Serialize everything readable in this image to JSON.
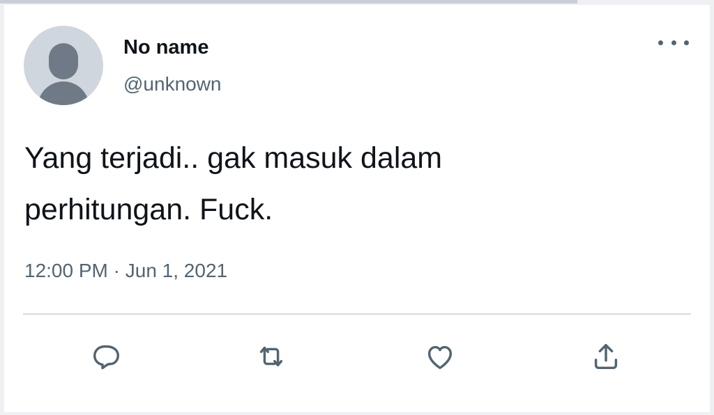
{
  "tweet": {
    "author_name": "No name",
    "author_handle": "@unknown",
    "text_line1": "Yang terjadi.. gak masuk dalam",
    "text_line2": "perhitungan. Fuck.",
    "time": "12:00 PM",
    "separator": "·",
    "date": "Jun 1, 2021"
  },
  "icons": {
    "more": "more-options-icon",
    "reply": "reply-icon",
    "retweet": "retweet-icon",
    "like": "like-icon",
    "share": "share-icon"
  },
  "colors": {
    "text_primary": "#0f1419",
    "text_secondary": "#536471",
    "avatar_bg": "#cfd6de",
    "avatar_fg": "#6f7a86",
    "divider": "#d6dbe0"
  }
}
